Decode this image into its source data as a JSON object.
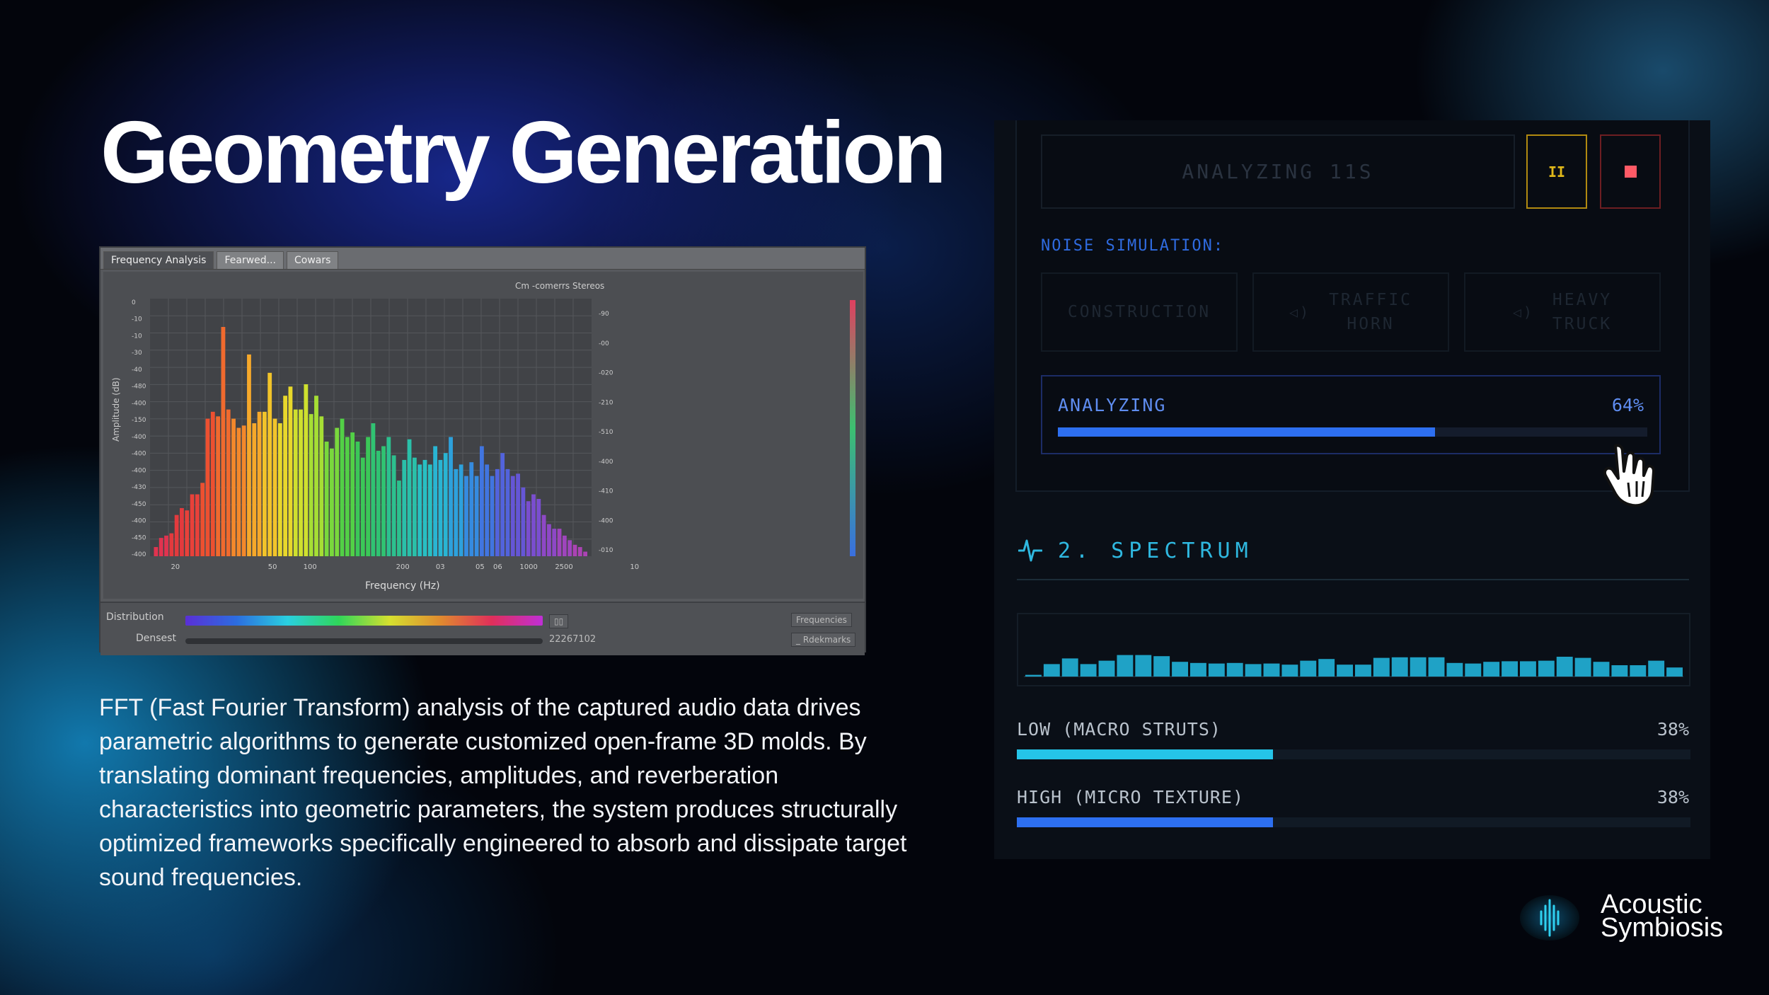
{
  "slide": {
    "title": "Geometry Generation",
    "description": "FFT (Fast Fourier Transform) analysis of the captured audio data drives parametric algorithms to generate customized open-frame 3D molds. By translating dominant frequencies, amplitudes, and reverberation characteristics into geometric parameters, the system produces structurally optimized frameworks specifically engineered to absorb and dissipate target sound frequencies."
  },
  "fft_screenshot": {
    "tabs": [
      "Frequency Analysis",
      "Fearwed...",
      "Cowars"
    ],
    "legend_text": "Cm -comerrs Stereos",
    "y_axis_label": "Amplitude (dB)",
    "x_axis_label": "Frequency (Hz)",
    "x_ticks": [
      "20",
      "50",
      "100",
      "200",
      "03",
      "05",
      "06",
      "1000",
      "2500",
      "10"
    ],
    "y_ticks_left": [
      "0",
      "-10",
      "-10",
      "-30",
      "-40",
      "-480",
      "-400",
      "-150",
      "-400",
      "-400",
      "-400",
      "-430",
      "-450",
      "-400",
      "-450",
      "-400"
    ],
    "y_ticks_right": [
      "-90",
      "-00",
      "-020",
      "-210",
      "-510",
      "-400",
      "-410",
      "-400",
      "-010"
    ],
    "footer": {
      "row1_label": "Distribution",
      "row2_label": "Densest",
      "value_text": "22267102",
      "button1": "Frequencies",
      "button2": "_ Rdekmarks"
    }
  },
  "chart_data": {
    "type": "bar",
    "title": "",
    "xlabel": "Frequency (Hz)",
    "ylabel": "Amplitude (dB)",
    "values": [
      4,
      8,
      9,
      10,
      18,
      21,
      20,
      27,
      27,
      32,
      60,
      63,
      61,
      100,
      64,
      60,
      56,
      57,
      88,
      58,
      63,
      63,
      80,
      60,
      58,
      70,
      74,
      64,
      64,
      75,
      62,
      70,
      61,
      50,
      47,
      56,
      60,
      52,
      54,
      50,
      43,
      52,
      58,
      46,
      48,
      52,
      44,
      33,
      42,
      51,
      43,
      40,
      42,
      40,
      48,
      42,
      45,
      52,
      38,
      40,
      35,
      41,
      35,
      48,
      40,
      35,
      38,
      45,
      38,
      35,
      36,
      30,
      24,
      27,
      25,
      18,
      14,
      12,
      12,
      9,
      7,
      5,
      4,
      2
    ],
    "colors": [
      "#e0334f",
      "#e33a3d",
      "#e8413a",
      "#ed5030",
      "#f06a2e",
      "#f3882b",
      "#f6a82a",
      "#f2c42a",
      "#e8d82b",
      "#cfe02e",
      "#a6de34",
      "#79d83c",
      "#52d046",
      "#3bc858",
      "#30c372",
      "#2cc08e",
      "#2ac0a9",
      "#28bfc3",
      "#29b5d3",
      "#2da1dc",
      "#358be0",
      "#4175e0",
      "#5263dc",
      "#6556d6",
      "#7a4ecf",
      "#8e48c6",
      "#9f45bd",
      "#ab43b4"
    ]
  },
  "panel": {
    "status_text": "ANALYZING 11S",
    "pause_icon": "pause-icon",
    "stop_icon": "stop-icon",
    "noise_label": "NOISE SIMULATION:",
    "noise_buttons": [
      {
        "label": "CONSTRUCTION"
      },
      {
        "label": "TRAFFIC HORN",
        "line1": "TRAFFIC",
        "line2": "HORN",
        "icon": "speaker-icon"
      },
      {
        "label": "HEAVY TRUCK",
        "line1": "HEAVY",
        "line2": "TRUCK",
        "icon": "speaker-icon"
      }
    ],
    "progress": {
      "label": "ANALYZING",
      "percent_text": "64%",
      "value": 0.64
    },
    "spectrum": {
      "icon": "waveform-icon",
      "title": "2. SPECTRUM",
      "bars": [
        0.03,
        0.22,
        0.32,
        0.22,
        0.28,
        0.38,
        0.38,
        0.36,
        0.26,
        0.24,
        0.23,
        0.24,
        0.22,
        0.23,
        0.21,
        0.28,
        0.31,
        0.21,
        0.21,
        0.33,
        0.34,
        0.34,
        0.34,
        0.24,
        0.23,
        0.26,
        0.27,
        0.27,
        0.28,
        0.35,
        0.33,
        0.26,
        0.2,
        0.2,
        0.28,
        0.16
      ],
      "bar_color": "#1fa2c6"
    },
    "bands": [
      {
        "label": "LOW (MACRO STRUTS)",
        "percent_text": "38%",
        "value": 0.38,
        "color": "#25c4e8"
      },
      {
        "label": "HIGH (MICRO TEXTURE)",
        "percent_text": "38%",
        "value": 0.38,
        "color": "#2d6ff0"
      }
    ]
  },
  "brand": {
    "name_line1": "Acoustic",
    "name_line2": "Symbiosis",
    "logo_icon": "logo-icon"
  }
}
